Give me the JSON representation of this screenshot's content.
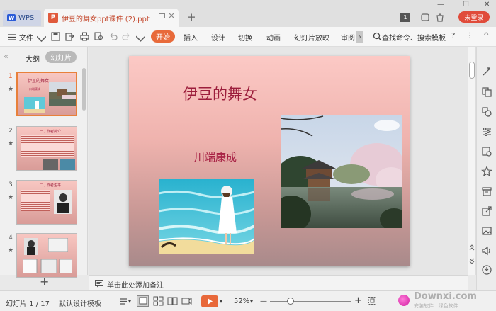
{
  "tabs": {
    "wps_label": "WPS",
    "wps_logo_letter": "W",
    "doc_icon_letter": "P",
    "doc_title": "伊豆的舞女ppt课件 (2).ppt",
    "add_tab": "+"
  },
  "window": {
    "page_badge": "1",
    "login_button": "未登录",
    "minimize": "—",
    "restore": "☐",
    "close": "✕"
  },
  "menu": {
    "file": "文件",
    "start": "开始",
    "insert": "插入",
    "design": "设计",
    "switch": "切换",
    "animation": "动画",
    "slideshow": "幻灯片放映",
    "review": "审阅",
    "more": "›",
    "search": "查找命令、搜索模板",
    "help": "?",
    "more_menu": "⋮",
    "collapse": "^"
  },
  "left_panel": {
    "collapse": "«",
    "tab_outline": "大纲",
    "tab_slides": "幻灯片",
    "add_slide": "+",
    "slide_numbers": [
      "1",
      "2",
      "3",
      "4"
    ],
    "star": "★",
    "thumb1_title": "伊豆的舞女",
    "thumb1_author": "川端康成",
    "thumb2_title": "一、作者简介",
    "thumb3_title": "二、作者生平"
  },
  "slide": {
    "title": "伊豆的舞女",
    "author": "川端康成"
  },
  "notes": {
    "placeholder": "单击此处添加备注"
  },
  "statusbar": {
    "slide_counter": "幻灯片 1 / 17",
    "template": "默认设计模板",
    "zoom": "52%",
    "zoom_minus": "—",
    "zoom_plus": "+",
    "dropdown_arrow": "▾"
  },
  "watermark": {
    "site": "Downxi.com",
    "sub": "安装软件 · 绿色软件"
  },
  "colors": {
    "accent": "#e8683a",
    "login_red": "#e04b3a",
    "title_red": "#9c1e3c"
  }
}
